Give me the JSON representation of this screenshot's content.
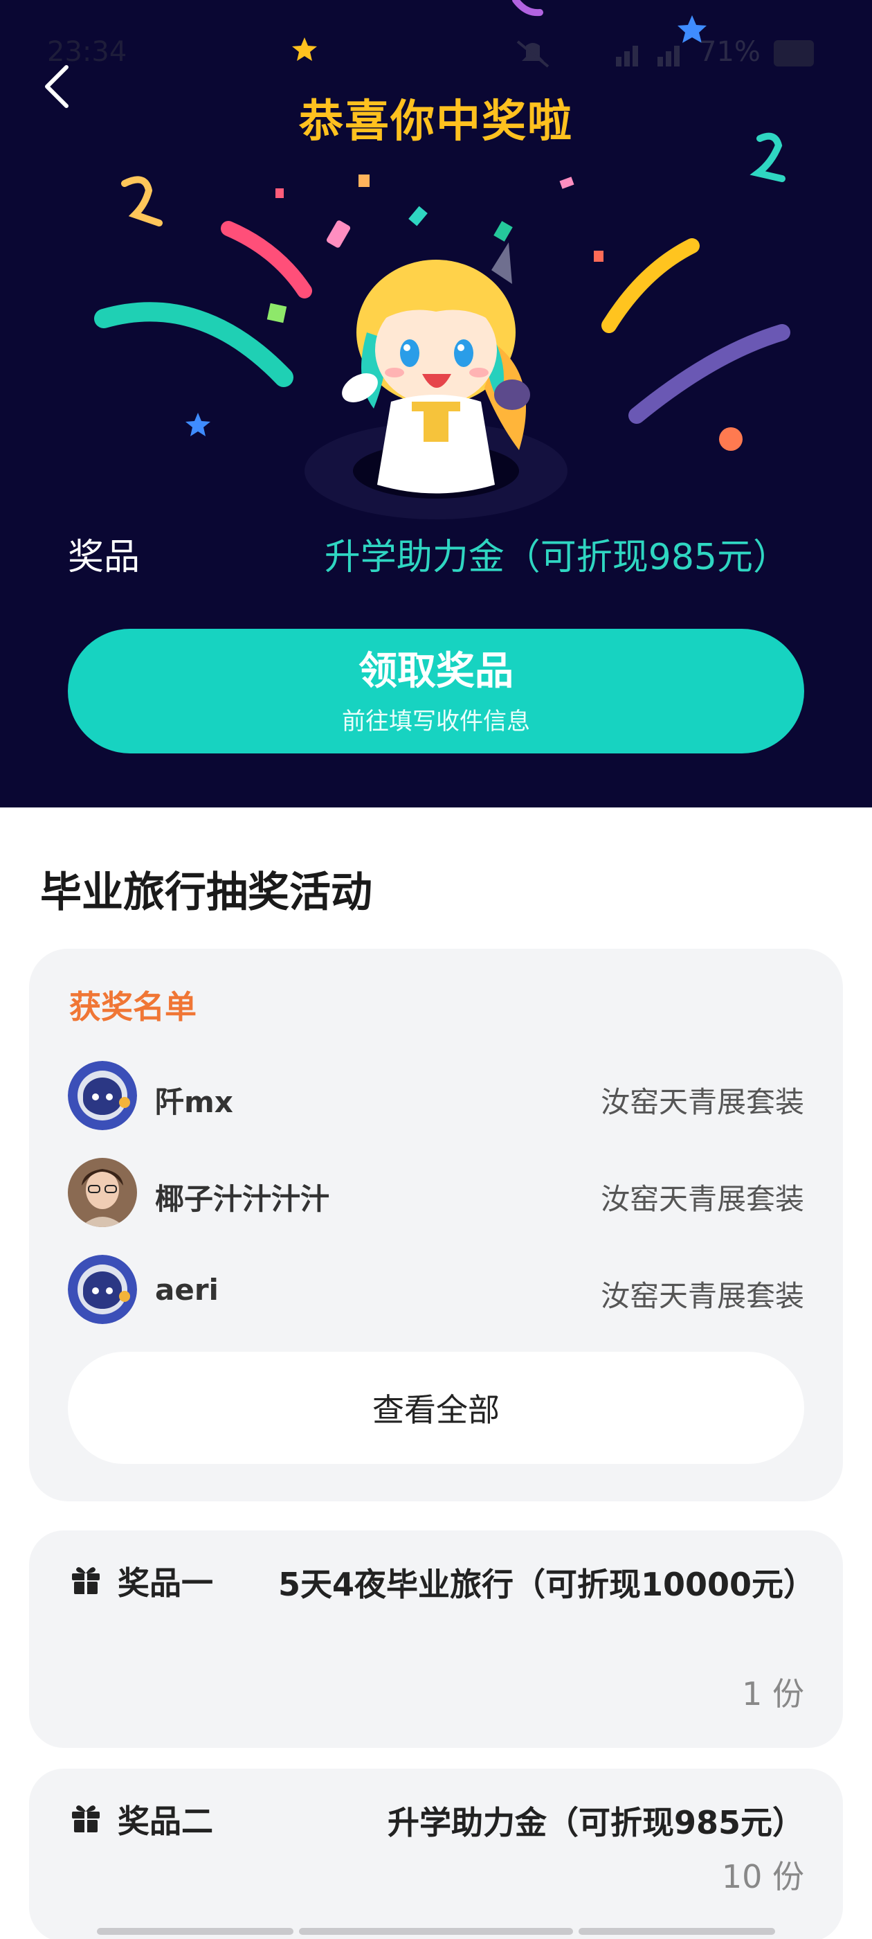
{
  "status_bar": {
    "time": "23:34",
    "battery": "71%"
  },
  "hero": {
    "title": "恭喜你中奖啦",
    "prize_label": "奖品",
    "prize_value": "升学助力金（可折现985元）",
    "claim_button": {
      "label": "领取奖品",
      "sublabel": "前往填写收件信息"
    }
  },
  "activity": {
    "title": "毕业旅行抽奖活动",
    "winners": {
      "heading": "获奖名单",
      "list": [
        {
          "name": "阡mx",
          "award": "汝窑天青展套装"
        },
        {
          "name": "椰子汁汁汁汁",
          "award": "汝窑天青展套装"
        },
        {
          "name": "aeri",
          "award": "汝窑天青展套装"
        }
      ],
      "view_all": "查看全部"
    },
    "prizes": [
      {
        "name": "奖品一",
        "description": "5天4夜毕业旅行（可折现10000元）",
        "count": "1 份"
      },
      {
        "name": "奖品二",
        "description": "升学助力金（可折现985元）",
        "count": "10 份"
      }
    ]
  },
  "colors": {
    "hero_background": "#0a0733",
    "title_gold": "#ffc11f",
    "accent_teal": "#17d3c1",
    "prize_teal": "#2fd6c2",
    "winners_heading_orange": "#f07635",
    "card_background": "#f3f4f6"
  },
  "icons": {
    "back": "chevron-left-icon",
    "gift": "gift-icon",
    "mute": "bell-off-icon",
    "signal": "signal-icon",
    "battery": "battery-icon"
  }
}
